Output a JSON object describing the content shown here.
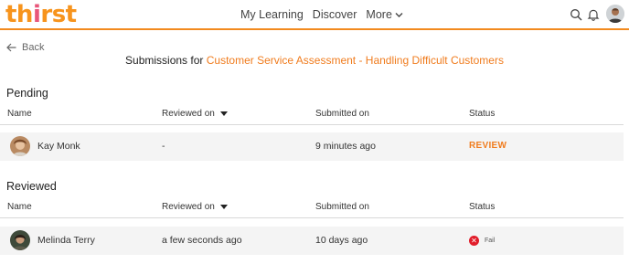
{
  "app": {
    "logo_parts": [
      "th",
      "i",
      "rst"
    ],
    "brand_color": "#f7941d",
    "accent_color": "#f07c1e"
  },
  "nav": {
    "items": [
      "My Learning",
      "Discover",
      "More"
    ],
    "icons": [
      "search-icon",
      "bell-icon",
      "user-avatar"
    ]
  },
  "back": {
    "label": "Back"
  },
  "page": {
    "title_prefix": "Submissions for",
    "course_name": "Customer Service Assessment - Handling Difficult Customers"
  },
  "pending": {
    "label": "Pending",
    "columns": [
      "Name",
      "Reviewed on",
      "Submitted on",
      "Status"
    ],
    "rows": [
      {
        "name": "Kay Monk",
        "reviewed_on": "-",
        "submitted_on": "9 minutes ago",
        "status": "REVIEW"
      }
    ]
  },
  "reviewed": {
    "label": "Reviewed",
    "columns": [
      "Name",
      "Reviewed on",
      "Submitted on",
      "Status"
    ],
    "rows": [
      {
        "name": "Melinda Terry",
        "reviewed_on": "a few seconds ago",
        "submitted_on": "10 days ago",
        "status": "Fail",
        "status_color": "#e11d2a"
      }
    ]
  }
}
